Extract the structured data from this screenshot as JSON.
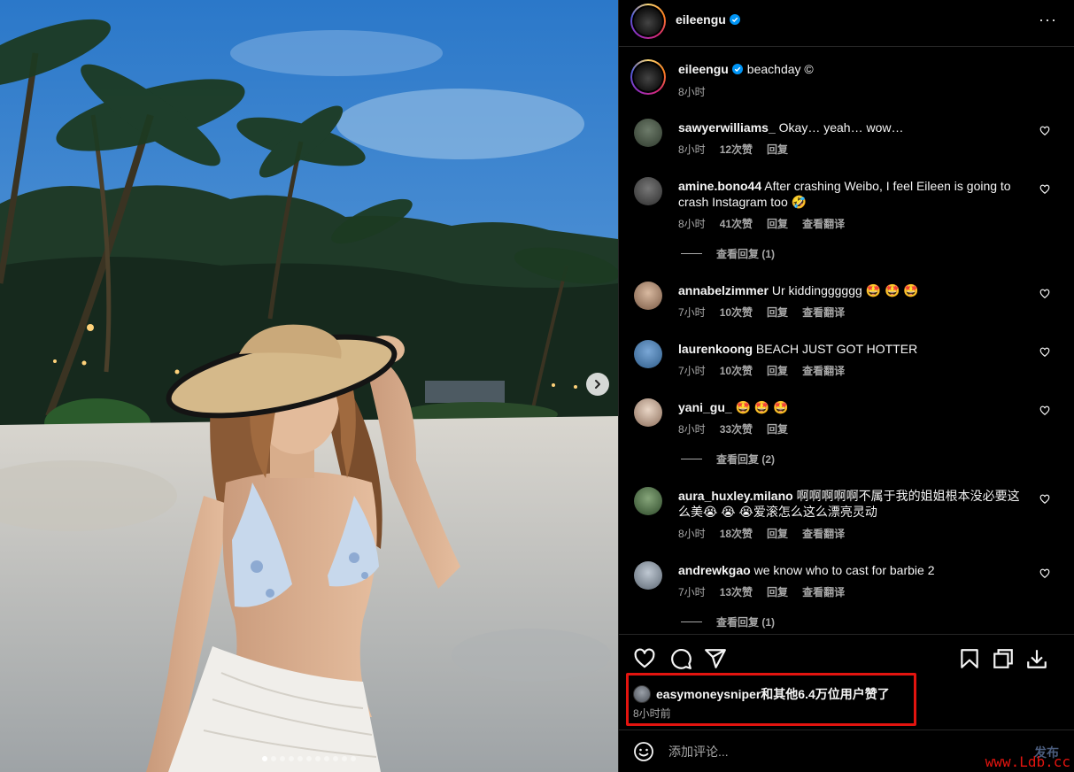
{
  "post": {
    "username": "eileengu",
    "caption_text": "beachday ©",
    "caption_time": "8小时",
    "image_dots": 11,
    "active_dot": 0
  },
  "comments": [
    {
      "user": "sawyerwilliams_",
      "text": "Okay… yeah… wow…",
      "time": "8小时",
      "likes": "12次赞",
      "reply": "回复",
      "translate": "",
      "view_replies": ""
    },
    {
      "user": "amine.bono44",
      "text": "After crashing Weibo, I feel Eileen is going to crash Instagram too 🤣",
      "time": "8小时",
      "likes": "41次赞",
      "reply": "回复",
      "translate": "查看翻译",
      "view_replies": "查看回复 (1)"
    },
    {
      "user": "annabelzimmer",
      "text": "Ur kiddingggggg 🤩 🤩 🤩",
      "time": "7小时",
      "likes": "10次赞",
      "reply": "回复",
      "translate": "查看翻译",
      "view_replies": ""
    },
    {
      "user": "laurenkoong",
      "text": "BEACH JUST GOT HOTTER",
      "time": "7小时",
      "likes": "10次赞",
      "reply": "回复",
      "translate": "查看翻译",
      "view_replies": ""
    },
    {
      "user": "yani_gu_",
      "text": "🤩 🤩 🤩",
      "time": "8小时",
      "likes": "33次赞",
      "reply": "回复",
      "translate": "",
      "view_replies": "查看回复 (2)"
    },
    {
      "user": "aura_huxley.milano",
      "text": "啊啊啊啊啊不属于我的姐姐根本没必要这么美😭 😭 😭爱滚怎么这么漂亮灵动",
      "time": "8小时",
      "likes": "18次赞",
      "reply": "回复",
      "translate": "查看翻译",
      "view_replies": ""
    },
    {
      "user": "andrewkgao",
      "text": "we know who to cast for barbie 2",
      "time": "7小时",
      "likes": "13次赞",
      "reply": "回复",
      "translate": "查看翻译",
      "view_replies": "查看回复 (1)"
    }
  ],
  "likes": {
    "text": "easymoneysniper和其他6.4万位用户赞了",
    "time": "8小时前"
  },
  "composer": {
    "placeholder": "添加评论...",
    "post_label": "发布"
  },
  "watermark": "www.Ldb.cc",
  "colors": {
    "background": "#000000",
    "text": "#f5f5f5",
    "muted": "#a8a8a8",
    "verified": "#0095f6",
    "highlight_box": "#e3140f"
  },
  "icons": {
    "header_more": "more-icon",
    "next": "chevron-right-icon",
    "like": "heart-icon",
    "comment": "comment-icon",
    "share": "send-icon",
    "save": "bookmark-icon",
    "copy": "copy-icon",
    "download": "download-icon",
    "emoji": "emoji-icon"
  }
}
